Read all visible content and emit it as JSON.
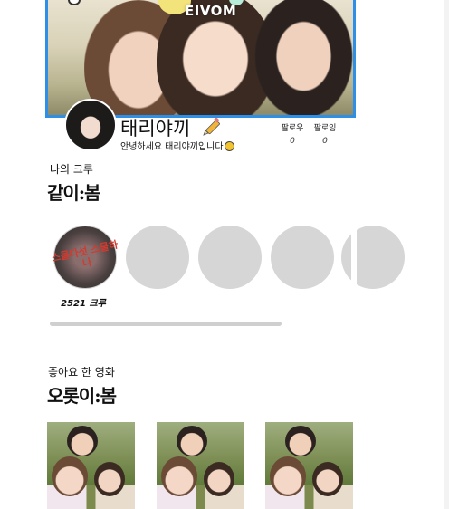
{
  "banner": {
    "logo": "EIVOM"
  },
  "profile": {
    "username": "태리야끼",
    "bio": "안녕하세요 태리야끼입니다",
    "followers_label": "팔로우",
    "followers_count": "0",
    "following_label": "팔로잉",
    "following_count": "0"
  },
  "crew_section": {
    "subtitle": "나의 크루",
    "title": "같이:봄",
    "crews": [
      {
        "name": "2521 크루",
        "poster_text": "스물다섯 스물하나"
      }
    ],
    "placeholder_count": 4
  },
  "liked_section": {
    "subtitle": "좋아요 한 영화",
    "title": "오롯이:봄"
  },
  "colors": {
    "banner_border": "#2d8fe8",
    "placeholder_circle": "#d6d6d6",
    "scrollbar": "#cfcfcf"
  }
}
